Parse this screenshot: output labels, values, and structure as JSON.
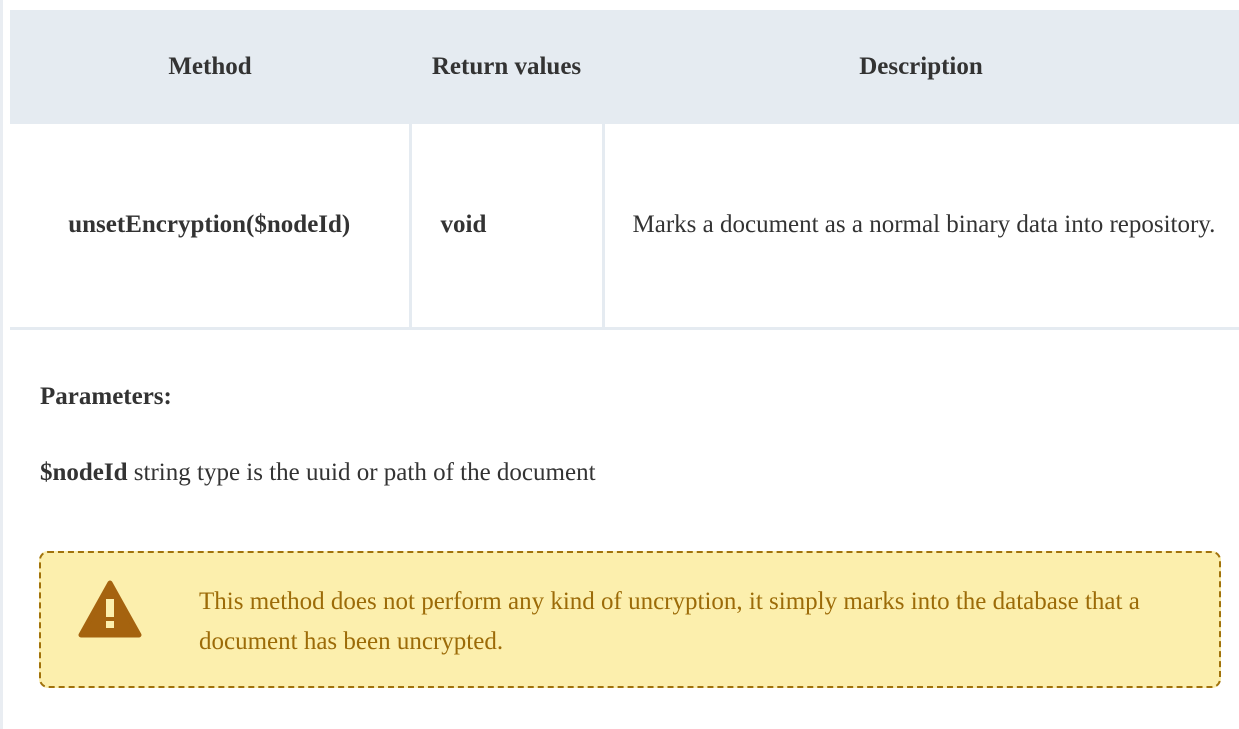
{
  "table": {
    "headers": {
      "method": "Method",
      "return_values": "Return values",
      "description": "Description"
    },
    "rows": [
      {
        "method": "unsetEncryption($nodeId)",
        "return_value": "void",
        "description": "Marks a document as a normal binary data into repository."
      }
    ]
  },
  "parameters": {
    "label": "Parameters:",
    "items": [
      {
        "name": "$nodeId",
        "description": "string type is the uuid or path of the document"
      }
    ]
  },
  "warning": {
    "icon": "warning-triangle-icon",
    "text": "This method does not perform any kind of uncryption, it simply marks into the database that a document has been uncrypted.",
    "colors": {
      "background": "#fcefad",
      "border": "#a1720b",
      "text": "#9c6b08",
      "icon": "#a5630f"
    }
  },
  "colors": {
    "header_background": "#e5ebf1",
    "text": "#333333"
  }
}
